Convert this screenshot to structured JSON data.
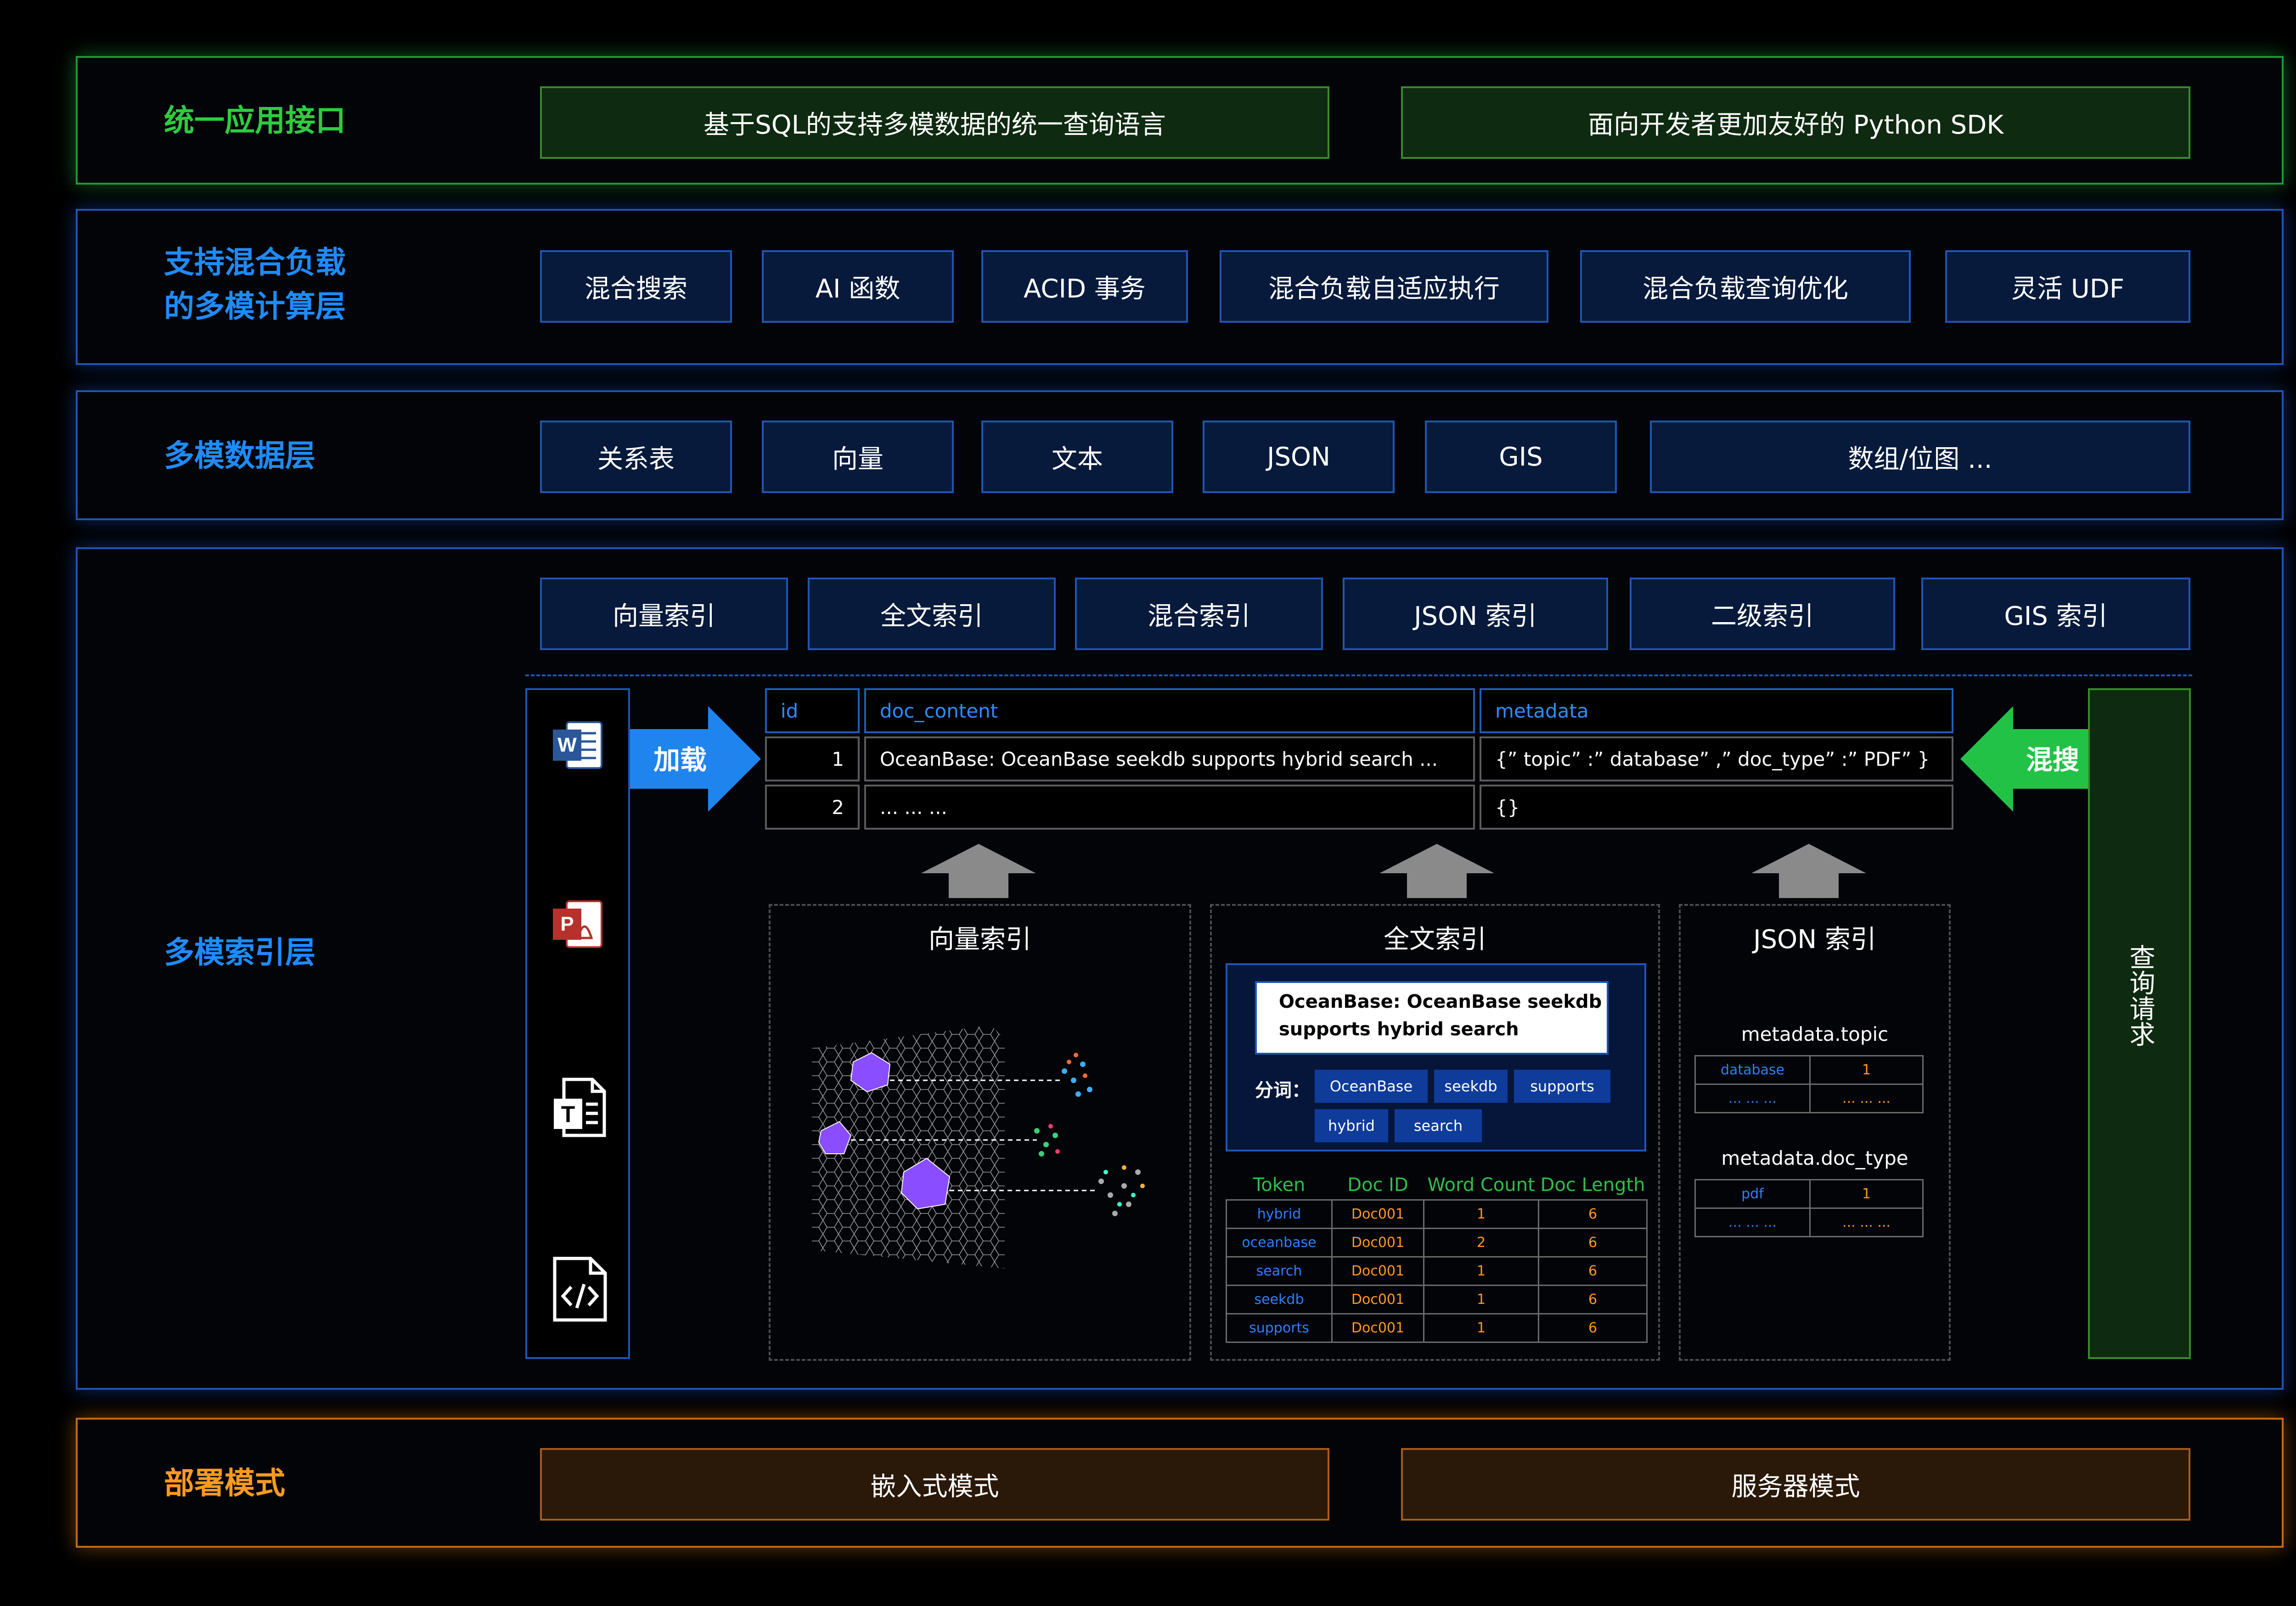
{
  "layers": {
    "api": {
      "title": "统一应用接口",
      "items": [
        "基于SQL的支持多模数据的统一查询语言",
        "面向开发者更加友好的 Python SDK"
      ]
    },
    "compute": {
      "title_line1": "支持混合负载",
      "title_line2": "的多模计算层",
      "items": [
        "混合搜索",
        "AI 函数",
        "ACID 事务",
        "混合负载自适应执行",
        "混合负载查询优化",
        "灵活 UDF"
      ]
    },
    "data": {
      "title": "多模数据层",
      "items": [
        "关系表",
        "向量",
        "文本",
        "JSON",
        "GIS",
        "数组/位图 ..."
      ]
    },
    "index": {
      "title": "多模索引层",
      "items": [
        "向量索引",
        "全文索引",
        "混合索引",
        "JSON 索引",
        "二级索引",
        "GIS 索引"
      ],
      "load_label": "加载",
      "hybrid_label": "混搜",
      "query_label": "查询请求",
      "table": {
        "headers": [
          "id",
          "doc_content",
          "metadata"
        ],
        "rows": [
          [
            "1",
            "OceanBase: OceanBase seekdb supports hybrid search ...",
            "{” topic” :” database” ,” doc_type” :” PDF” }"
          ],
          [
            "2",
            "... ... ...",
            "{}"
          ]
        ]
      },
      "vector_panel": {
        "title": "向量索引"
      },
      "fulltext_panel": {
        "title": "全文索引",
        "doc_text_line1": "OceanBase: OceanBase seekdb",
        "doc_text_line2": "supports hybrid search",
        "tokenize_label": "分词：",
        "tokens": [
          "OceanBase",
          "seekdb",
          "supports",
          "hybrid",
          "search"
        ],
        "columns": [
          "Token",
          "Doc ID",
          "Word Count",
          "Doc Length"
        ],
        "rows": [
          [
            "hybrid",
            "Doc001",
            "1",
            "6"
          ],
          [
            "oceanbase",
            "Doc001",
            "2",
            "6"
          ],
          [
            "search",
            "Doc001",
            "1",
            "6"
          ],
          [
            "seekdb",
            "Doc001",
            "1",
            "6"
          ],
          [
            "supports",
            "Doc001",
            "1",
            "6"
          ]
        ]
      },
      "json_panel": {
        "title": "JSON 索引",
        "topic_label": "metadata.topic",
        "topic_rows": [
          [
            "database",
            "1"
          ],
          [
            "... ... ...",
            "... ... ..."
          ]
        ],
        "doctype_label": "metadata.doc_type",
        "doctype_rows": [
          [
            "pdf",
            "1"
          ],
          [
            "... ... ...",
            "... ... ..."
          ]
        ]
      }
    },
    "deploy": {
      "title": "部署模式",
      "items": [
        "嵌入式模式",
        "服务器模式"
      ]
    }
  },
  "file_icons": [
    "word-doc-icon",
    "pdf-doc-icon",
    "text-doc-icon",
    "code-doc-icon"
  ],
  "colors": {
    "green": "#2ecc40",
    "blue": "#1e8cff",
    "orange": "#ff9a1f",
    "token_blue": "#2f7fff",
    "doc_orange": "#ff9a1f"
  }
}
